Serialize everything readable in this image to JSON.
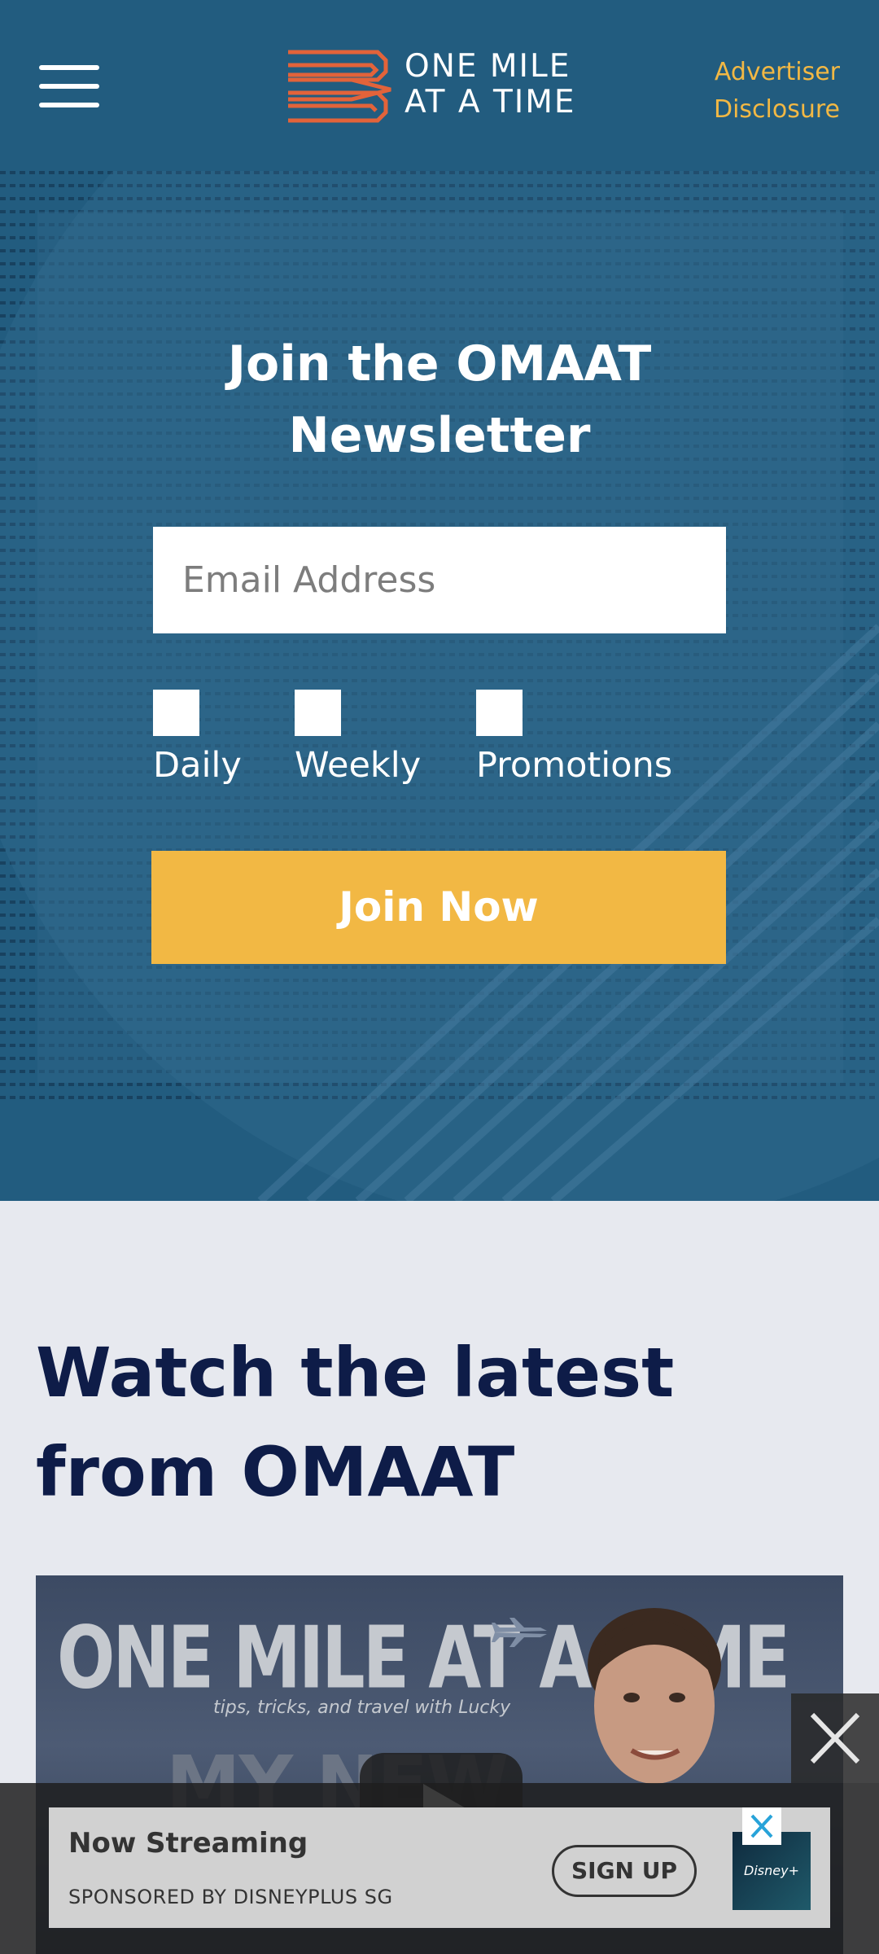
{
  "header": {
    "logo_line1": "ONE MILE",
    "logo_line2": "AT A TIME",
    "advertiser_line1": "Advertiser",
    "advertiser_line2": "Disclosure",
    "brand_color": "#225c7f",
    "logo_color": "#e2633a",
    "accent_color": "#f2b844"
  },
  "newsletter": {
    "title": "Join the OMAAT Newsletter",
    "email_placeholder": "Email Address",
    "options": [
      {
        "label": "Daily",
        "checked": false
      },
      {
        "label": "Weekly",
        "checked": false
      },
      {
        "label": "Promotions",
        "checked": false
      }
    ],
    "button_label": "Join Now"
  },
  "watch": {
    "title_line1": "Watch the latest",
    "title_line2": "from OMAAT",
    "video_title": "ONE MILE AT A TIME",
    "video_subtitle": "tips, tricks, and travel with Lucky",
    "video_text": "MY NEW"
  },
  "ad": {
    "title": "Now Streaming",
    "sponsor": "SPONSORED BY DISNEYPLUS SG",
    "button": "SIGN UP",
    "thumb_text": "Disney+"
  }
}
